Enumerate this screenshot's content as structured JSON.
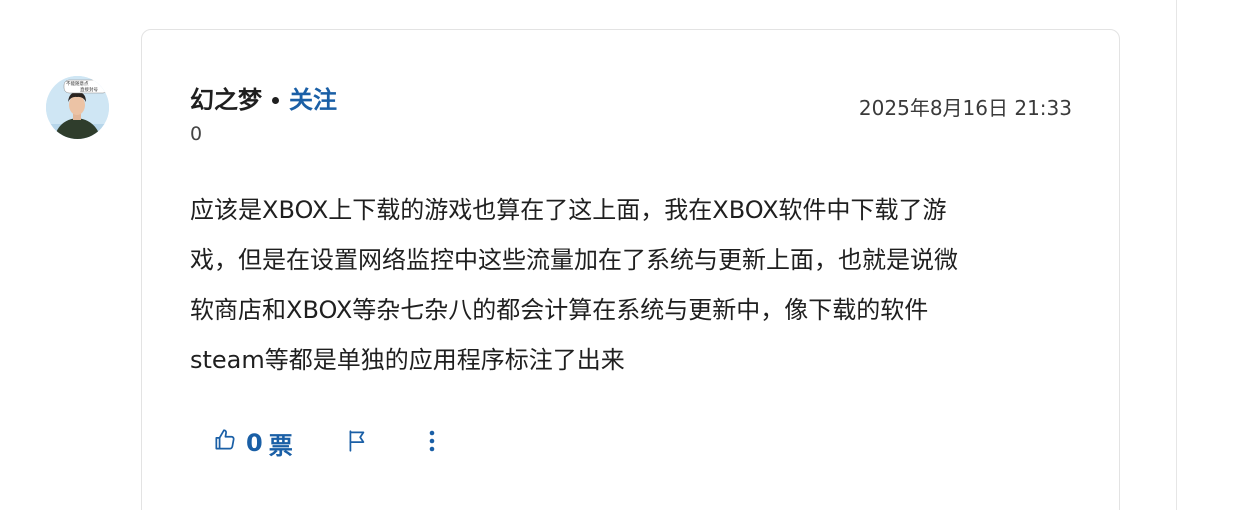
{
  "post": {
    "author": "幻之梦",
    "follow_label": "关注",
    "reputation": "0",
    "timestamp": "2025年8月16日 21:33",
    "avatar_caption_1": "不能随意点",
    "avatar_caption_2": "直接封号",
    "body_lines": [
      "应该是XBOX上下载的游戏也算在了这上面，我在XBOX软件中下载了游",
      "戏，但是在设置网络监控中这些流量加在了系统与更新上面，也就是说微",
      "软商店和XBOX等杂七杂八的都会计算在系统与更新中，像下载的软件",
      "steam等都是单独的应用程序标注了出来"
    ]
  },
  "actions": {
    "vote_count": "0",
    "vote_label": "票",
    "like_icon": "thumbs-up-icon",
    "report_icon": "flag-icon",
    "more_icon": "more-vertical-icon"
  },
  "colors": {
    "accent": "#1a5fa6",
    "text": "#1f1f1f",
    "border": "#e3e3e3"
  }
}
